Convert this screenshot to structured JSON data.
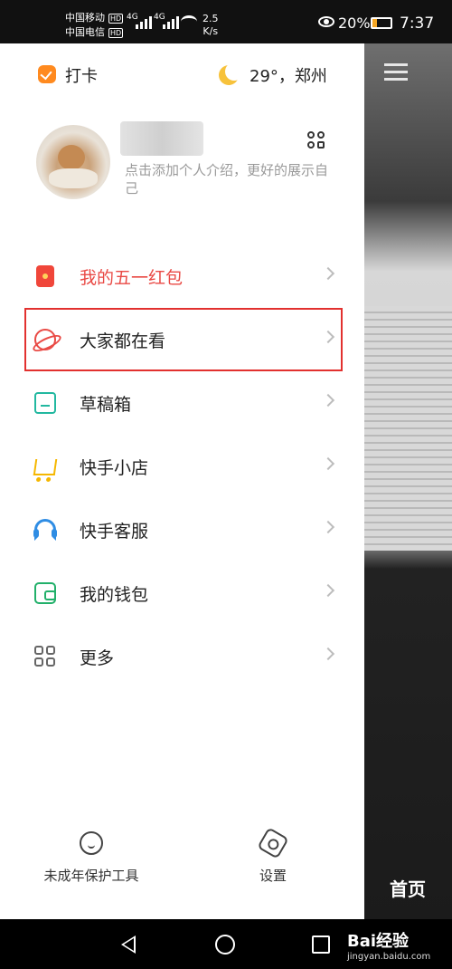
{
  "status_bar": {
    "carrier1": "中国移动",
    "carrier2": "中国电信",
    "hd": "HD",
    "net1": "4G",
    "net2": "4G",
    "speed_value": "2.5",
    "speed_unit": "K/s",
    "battery": "20%",
    "time": "7:37"
  },
  "header": {
    "checkin_label": "打卡",
    "weather": "29°，郑州"
  },
  "profile": {
    "bio": "点击添加个人介绍，更好的展示自己"
  },
  "menu": [
    {
      "label": "我的五一红包",
      "icon": "red-envelope-icon"
    },
    {
      "label": "大家都在看",
      "icon": "planet-icon"
    },
    {
      "label": "草稿箱",
      "icon": "folder-icon"
    },
    {
      "label": "快手小店",
      "icon": "cart-icon"
    },
    {
      "label": "快手客服",
      "icon": "headset-icon"
    },
    {
      "label": "我的钱包",
      "icon": "wallet-icon"
    },
    {
      "label": "更多",
      "icon": "grid-icon"
    }
  ],
  "bottom": {
    "minor_tool": "未成年保护工具",
    "settings": "设置"
  },
  "video": {
    "home_tab": "首页"
  },
  "watermark": {
    "brand": "Bai经验",
    "url": "jingyan.baidu.com"
  },
  "colors": {
    "accent_red": "#e94a45",
    "highlight_box": "#e2312f",
    "checkin_orange": "#ff8a1f"
  }
}
